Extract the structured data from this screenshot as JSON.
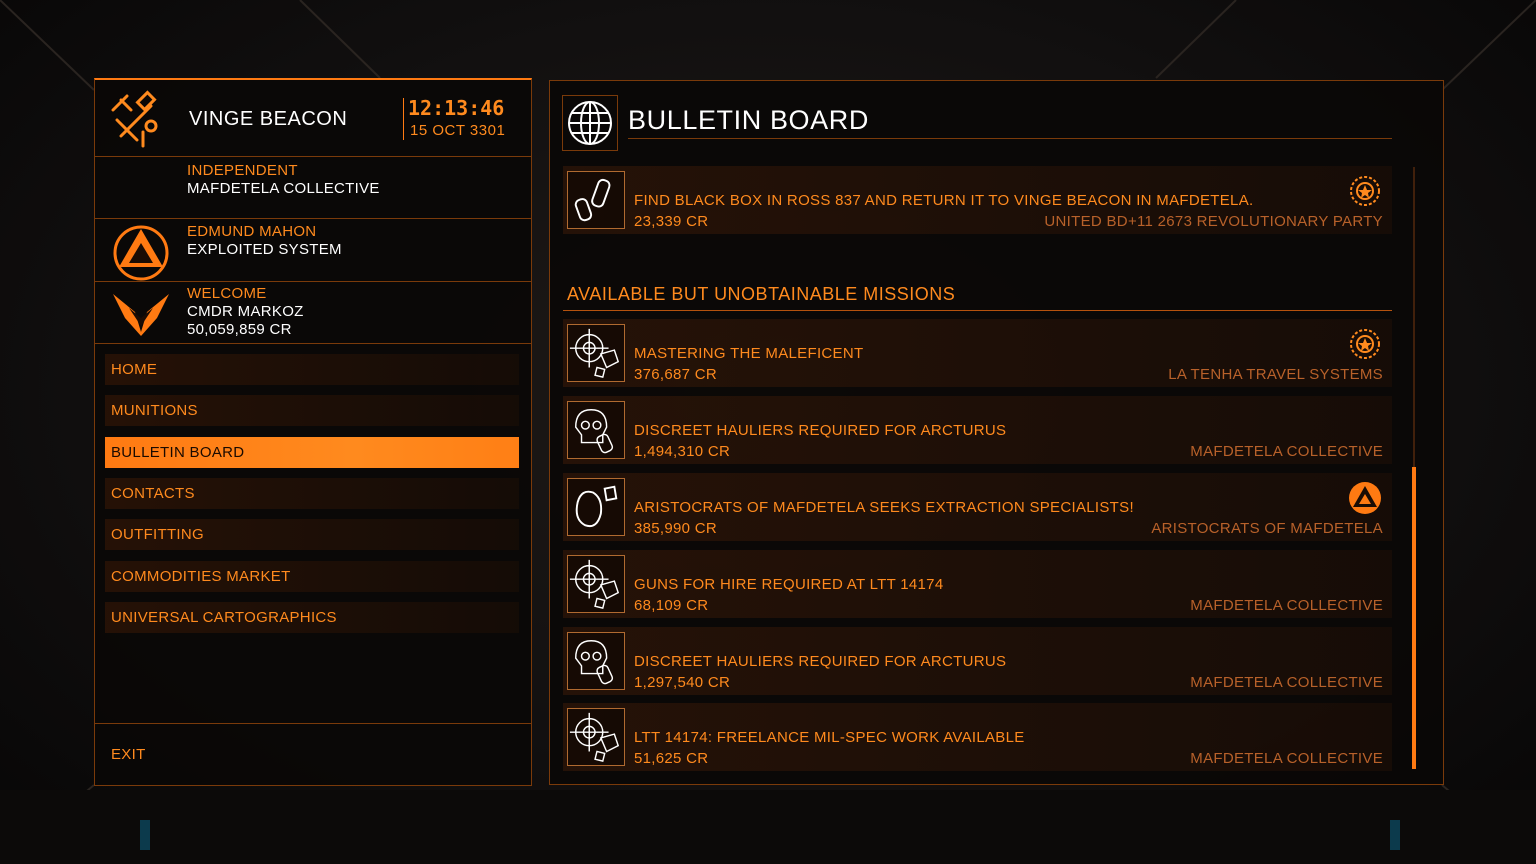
{
  "station": {
    "name": "VINGE BEACON",
    "time": "12:13:46",
    "date": "15 OCT 3301",
    "allegiance": "INDEPENDENT",
    "faction": "MAFDETELA COLLECTIVE"
  },
  "power": {
    "name": "EDMUND MAHON",
    "status": "EXPLOITED SYSTEM"
  },
  "commander": {
    "greeting": "WELCOME",
    "name": "CMDR MARKOZ",
    "credits": "50,059,859 CR"
  },
  "nav": {
    "items": [
      {
        "label": "HOME",
        "active": false
      },
      {
        "label": "MUNITIONS",
        "active": false
      },
      {
        "label": "BULLETIN BOARD",
        "active": true
      },
      {
        "label": "CONTACTS",
        "active": false
      },
      {
        "label": "OUTFITTING",
        "active": false
      },
      {
        "label": "COMMODITIES MARKET",
        "active": false
      },
      {
        "label": "UNIVERSAL CARTOGRAPHICS",
        "active": false
      }
    ],
    "exit_label": "EXIT"
  },
  "bulletin": {
    "title": "BULLETIN BOARD",
    "top_mission": {
      "title": "FIND BLACK BOX IN ROSS 837 AND RETURN IT TO VINGE BEACON IN MAFDETELA.",
      "reward": "23,339 CR",
      "faction": "UNITED BD+11 2673 REVOLUTIONARY PARTY",
      "icon": "black-box-icon",
      "badge": "federation-badge-icon"
    },
    "section_title": "AVAILABLE BUT UNOBTAINABLE MISSIONS",
    "missions": [
      {
        "title": "MASTERING THE MALEFICENT",
        "reward": "376,687 CR",
        "faction": "LA TENHA TRAVEL SYSTEMS",
        "icon": "crosshair-icon",
        "badge": "federation-badge-icon"
      },
      {
        "title": "DISCREET HAULIERS REQUIRED FOR ARCTURUS",
        "reward": "1,494,310 CR",
        "faction": "MAFDETELA COLLECTIVE",
        "icon": "skull-cargo-icon",
        "badge": ""
      },
      {
        "title": "ARISTOCRATS OF MAFDETELA SEEKS EXTRACTION SPECIALISTS!",
        "reward": "385,990 CR",
        "faction": "ARISTOCRATS OF MAFDETELA",
        "icon": "asteroid-icon",
        "badge": "power-badge-icon"
      },
      {
        "title": "GUNS FOR HIRE REQUIRED AT LTT 14174",
        "reward": "68,109 CR",
        "faction": "MAFDETELA COLLECTIVE",
        "icon": "crosshair-icon",
        "badge": ""
      },
      {
        "title": "DISCREET HAULIERS REQUIRED FOR ARCTURUS",
        "reward": "1,297,540 CR",
        "faction": "MAFDETELA COLLECTIVE",
        "icon": "skull-cargo-icon",
        "badge": ""
      },
      {
        "title": "LTT 14174: FREELANCE MIL-SPEC WORK AVAILABLE",
        "reward": "51,625 CR",
        "faction": "MAFDETELA COLLECTIVE",
        "icon": "crosshair-icon",
        "badge": ""
      }
    ]
  },
  "colors": {
    "accent": "#ff8a1e",
    "border": "#7a3a0a",
    "faction_text": "#b8612a"
  }
}
